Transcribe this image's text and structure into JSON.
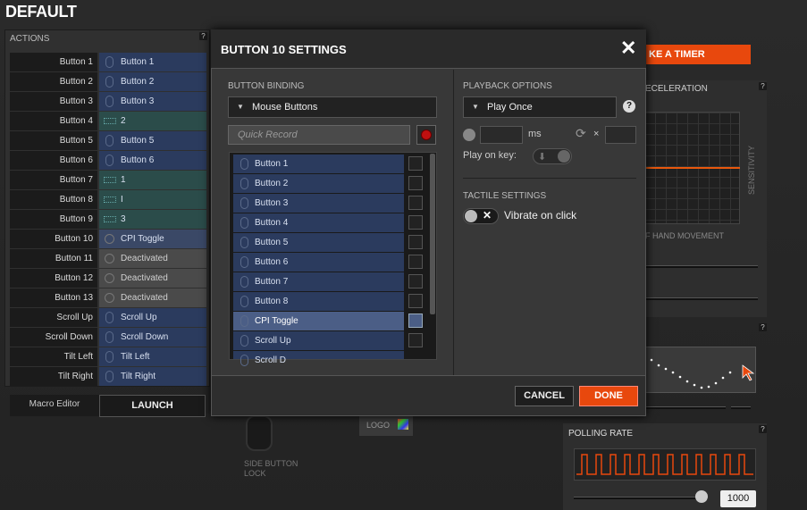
{
  "window": {
    "title": "DEFAULT"
  },
  "actions": {
    "title": "ACTIONS",
    "help": "?",
    "rows": [
      {
        "label": "Button 1",
        "value": "Button 1",
        "style": "blue",
        "icon": "mouse-icon"
      },
      {
        "label": "Button 2",
        "value": "Button 2",
        "style": "blue",
        "icon": "mouse-icon"
      },
      {
        "label": "Button 3",
        "value": "Button 3",
        "style": "blue",
        "icon": "mouse-icon"
      },
      {
        "label": "Button 4",
        "value": "2",
        "style": "teal",
        "icon": "keyboard-icon"
      },
      {
        "label": "Button 5",
        "value": "Button 5",
        "style": "blue",
        "icon": "mouse-icon"
      },
      {
        "label": "Button 6",
        "value": "Button 6",
        "style": "blue",
        "icon": "mouse-icon"
      },
      {
        "label": "Button 7",
        "value": "1",
        "style": "teal",
        "icon": "keyboard-icon"
      },
      {
        "label": "Button 8",
        "value": "I",
        "style": "teal",
        "icon": "keyboard-icon"
      },
      {
        "label": "Button 9",
        "value": "3",
        "style": "teal",
        "icon": "keyboard-icon"
      },
      {
        "label": "Button 10",
        "value": "CPI Toggle",
        "style": "sel",
        "icon": "cpi-icon"
      },
      {
        "label": "Button 11",
        "value": "Deactivated",
        "style": "gray",
        "icon": "disabled-icon"
      },
      {
        "label": "Button 12",
        "value": "Deactivated",
        "style": "gray",
        "icon": "disabled-icon"
      },
      {
        "label": "Button 13",
        "value": "Deactivated",
        "style": "gray",
        "icon": "disabled-icon"
      },
      {
        "label": "Scroll Up",
        "value": "Scroll Up",
        "style": "blue",
        "icon": "mouse-icon"
      },
      {
        "label": "Scroll Down",
        "value": "Scroll Down",
        "style": "blue",
        "icon": "mouse-icon"
      },
      {
        "label": "Tilt Left",
        "value": "Tilt Left",
        "style": "blue",
        "icon": "mouse-icon"
      },
      {
        "label": "Tilt Right",
        "value": "Tilt Right",
        "style": "blue",
        "icon": "mouse-icon"
      }
    ],
    "macro_label": "Macro Editor",
    "launch_label": "LAUNCH"
  },
  "right": {
    "timer_label": "KE A TIMER",
    "accel_label": "ECELERATION",
    "sensitivity_label": "SENSITIVITY",
    "hand_label": "F HAND MOVEMENT",
    "polling_label": "POLLING RATE",
    "polling_value": "1000",
    "help": "?"
  },
  "bottom": {
    "side_lock": "SIDE BUTTON",
    "side_lock2": "LOCK",
    "logo": "LOGO"
  },
  "dialog": {
    "title": "BUTTON 10 SETTINGS",
    "close": "✕",
    "binding_title": "BUTTON BINDING",
    "binding_value": "Mouse Buttons",
    "quick_record_placeholder": "Quick Record",
    "list": [
      {
        "label": "Button 1",
        "selected": false
      },
      {
        "label": "Button 2",
        "selected": false
      },
      {
        "label": "Button 3",
        "selected": false
      },
      {
        "label": "Button 4",
        "selected": false
      },
      {
        "label": "Button 5",
        "selected": false
      },
      {
        "label": "Button 6",
        "selected": false
      },
      {
        "label": "Button 7",
        "selected": false
      },
      {
        "label": "Button 8",
        "selected": false
      },
      {
        "label": "CPI Toggle",
        "selected": true
      },
      {
        "label": "Scroll Up",
        "selected": false
      },
      {
        "label": "Scroll D",
        "selected": false
      }
    ],
    "playback_title": "PLAYBACK OPTIONS",
    "playback_value": "Play Once",
    "help": "?",
    "ms_label": "ms",
    "times_label": "×",
    "play_on_key": "Play on key:",
    "tactile_title": "TACTILE SETTINGS",
    "vibrate_label": "Vibrate on click",
    "cancel": "CANCEL",
    "done": "DONE"
  },
  "colors": {
    "accent": "#e8480d",
    "binding_blue": "#2b3b5e",
    "keyboard_teal": "#2b4c4a"
  }
}
